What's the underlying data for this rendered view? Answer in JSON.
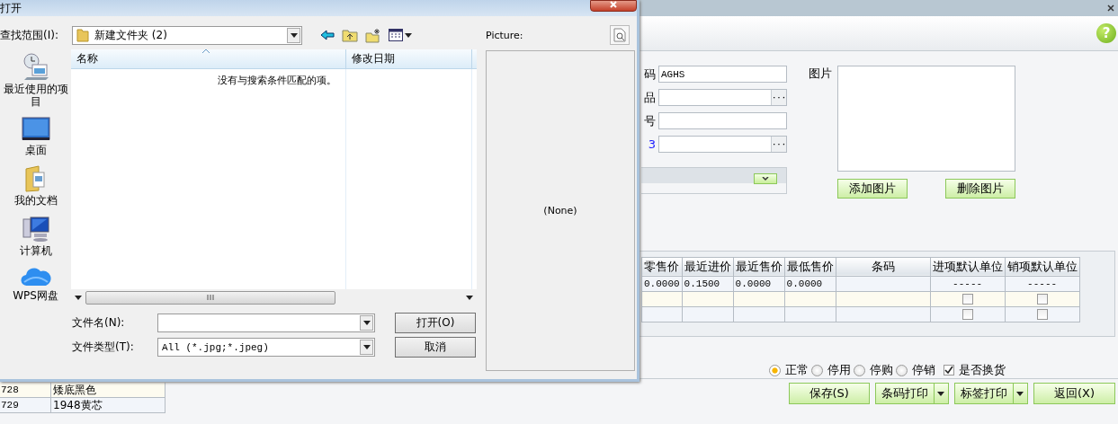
{
  "dialog": {
    "title": "打开",
    "look_in": {
      "label": "查找范围(I):",
      "value": "新建文件夹 (2)"
    },
    "places": [
      {
        "label": "最近使用的项目",
        "kind": "recent"
      },
      {
        "label": "桌面",
        "kind": "desktop"
      },
      {
        "label": "我的文档",
        "kind": "documents"
      },
      {
        "label": "计算机",
        "kind": "computer"
      },
      {
        "label": "WPS网盘",
        "kind": "cloud"
      }
    ],
    "file_list": {
      "columns": [
        "名称",
        "修改日期"
      ],
      "empty_message": "没有与搜索条件匹配的项。"
    },
    "file_name": {
      "label": "文件名(N):"
    },
    "file_type": {
      "label": "文件类型(T):",
      "value": "All (*.jpg;*.jpeg)"
    },
    "buttons": [
      "打开(O)",
      "取消"
    ],
    "preview": {
      "label": "Picture:",
      "value": "(None)"
    }
  },
  "app": {
    "help": "?",
    "fields": [
      {
        "label": "码",
        "link": false,
        "value": "AGHS"
      },
      {
        "label": "品",
        "link": false,
        "browse_button": "···"
      },
      {
        "label": "号",
        "link": false
      },
      {
        "label": "3",
        "link": true,
        "browse_button": "···"
      }
    ],
    "picture": {
      "label": "图片",
      "buttons": [
        "添加图片",
        "删除图片"
      ]
    },
    "grid": {
      "columns": [
        "零售价",
        "最近进价",
        "最近售价",
        "最低售价",
        "条码",
        "进项默认单位",
        "销项默认单位"
      ],
      "rows": [
        {
          "cells": [
            {
              "kind": "text",
              "text": "0.0000"
            },
            {
              "kind": "text",
              "text": "0.1500"
            },
            {
              "kind": "text",
              "text": "0.0000"
            },
            {
              "kind": "text",
              "text": "0.0000"
            },
            {
              "kind": "empty"
            },
            {
              "kind": "dash",
              "text": "-----"
            },
            {
              "kind": "dash",
              "text": "-----"
            }
          ]
        },
        {
          "cells": [
            {
              "kind": "empty"
            },
            {
              "kind": "empty"
            },
            {
              "kind": "empty"
            },
            {
              "kind": "empty"
            },
            {
              "kind": "empty"
            },
            {
              "kind": "checkbox",
              "checked": false
            },
            {
              "kind": "checkbox",
              "checked": false
            }
          ]
        },
        {
          "cells": [
            {
              "kind": "empty"
            },
            {
              "kind": "empty"
            },
            {
              "kind": "empty"
            },
            {
              "kind": "empty"
            },
            {
              "kind": "empty"
            },
            {
              "kind": "checkbox",
              "checked": false
            },
            {
              "kind": "checkbox",
              "checked": false
            }
          ]
        }
      ]
    },
    "status": [
      {
        "label": "正常",
        "selected": true
      },
      {
        "label": "停用",
        "selected": false
      },
      {
        "label": "停购",
        "selected": false
      },
      {
        "label": "停销",
        "selected": false
      }
    ],
    "exchange": {
      "label": "是否换货",
      "checked": true
    },
    "actions": [
      {
        "label": "保存(S)",
        "dropdown": false
      },
      {
        "label": "条码打印",
        "dropdown": true
      },
      {
        "label": "标签打印",
        "dropdown": true
      },
      {
        "label": "返回(X)",
        "dropdown": false
      }
    ],
    "records": [
      {
        "code": "728",
        "name": "矮底黑色"
      },
      {
        "code": "729",
        "name": "1948黄芯"
      }
    ]
  }
}
